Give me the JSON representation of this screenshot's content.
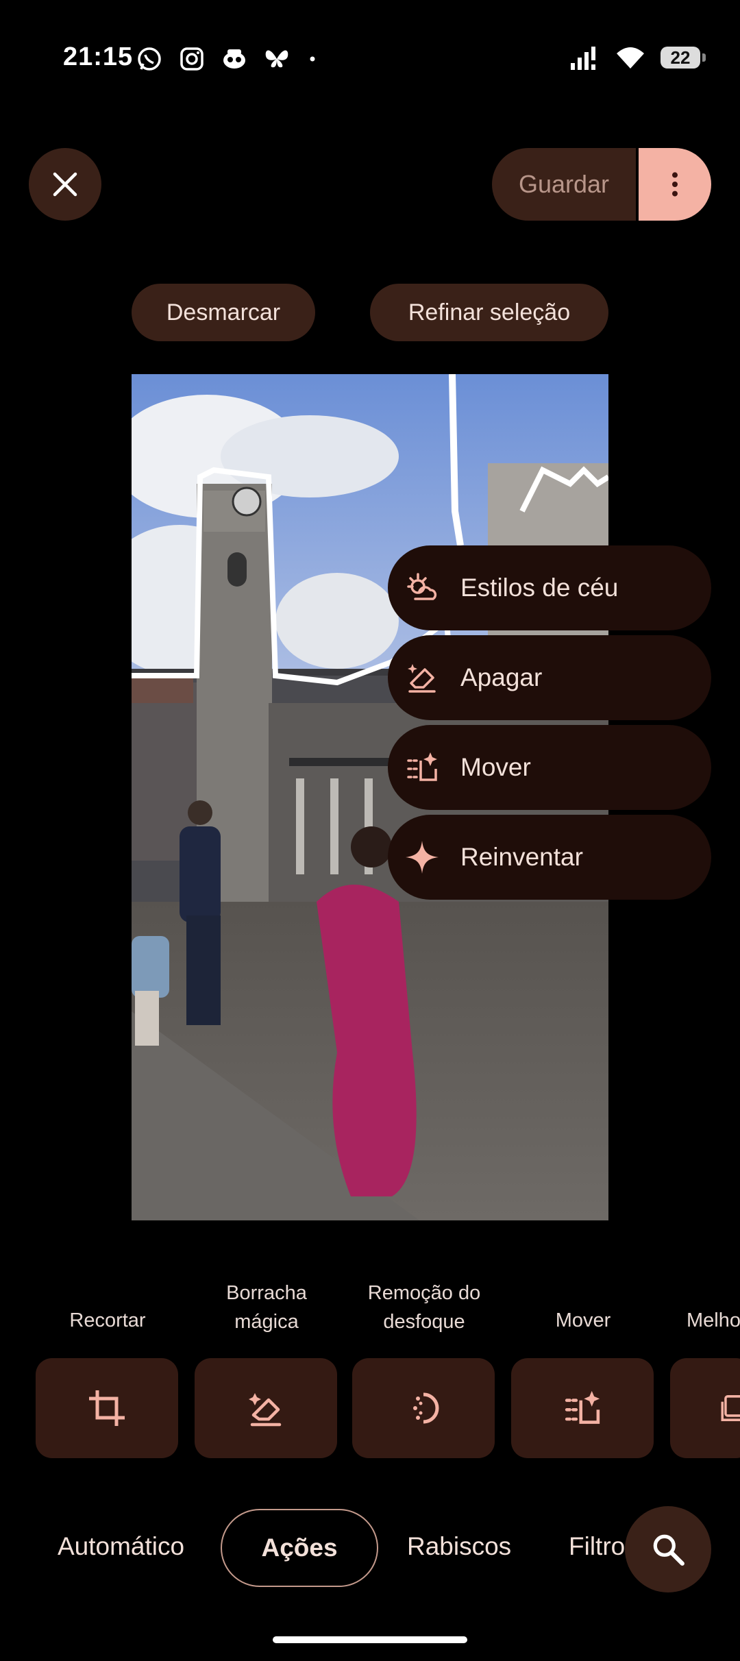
{
  "status": {
    "time": "21:15",
    "battery": "22"
  },
  "toolbar": {
    "save_label": "Guardar"
  },
  "selection": {
    "deselect": "Desmarcar",
    "refine": "Refinar seleção"
  },
  "menu": [
    {
      "label": "Estilos de céu",
      "icon": "sky-styles-icon"
    },
    {
      "label": "Apagar",
      "icon": "erase-icon"
    },
    {
      "label": "Mover",
      "icon": "move-icon"
    },
    {
      "label": "Reinventar",
      "icon": "sparkle-icon"
    }
  ],
  "tools": [
    {
      "label": "Recortar",
      "icon": "crop-icon"
    },
    {
      "label": "Borracha mágica",
      "icon": "magic-eraser-icon"
    },
    {
      "label": "Remoção do desfoque",
      "icon": "unblur-icon"
    },
    {
      "label": "Mover",
      "icon": "move-icon"
    },
    {
      "label": "Melho",
      "icon": "enhance-icon"
    }
  ],
  "tabs": [
    "Automático",
    "Ações",
    "Rabiscos",
    "Filtro"
  ],
  "colors": {
    "accent": "#f4b2a4",
    "chip": "#3a2118",
    "menu": "#1f0d09"
  }
}
